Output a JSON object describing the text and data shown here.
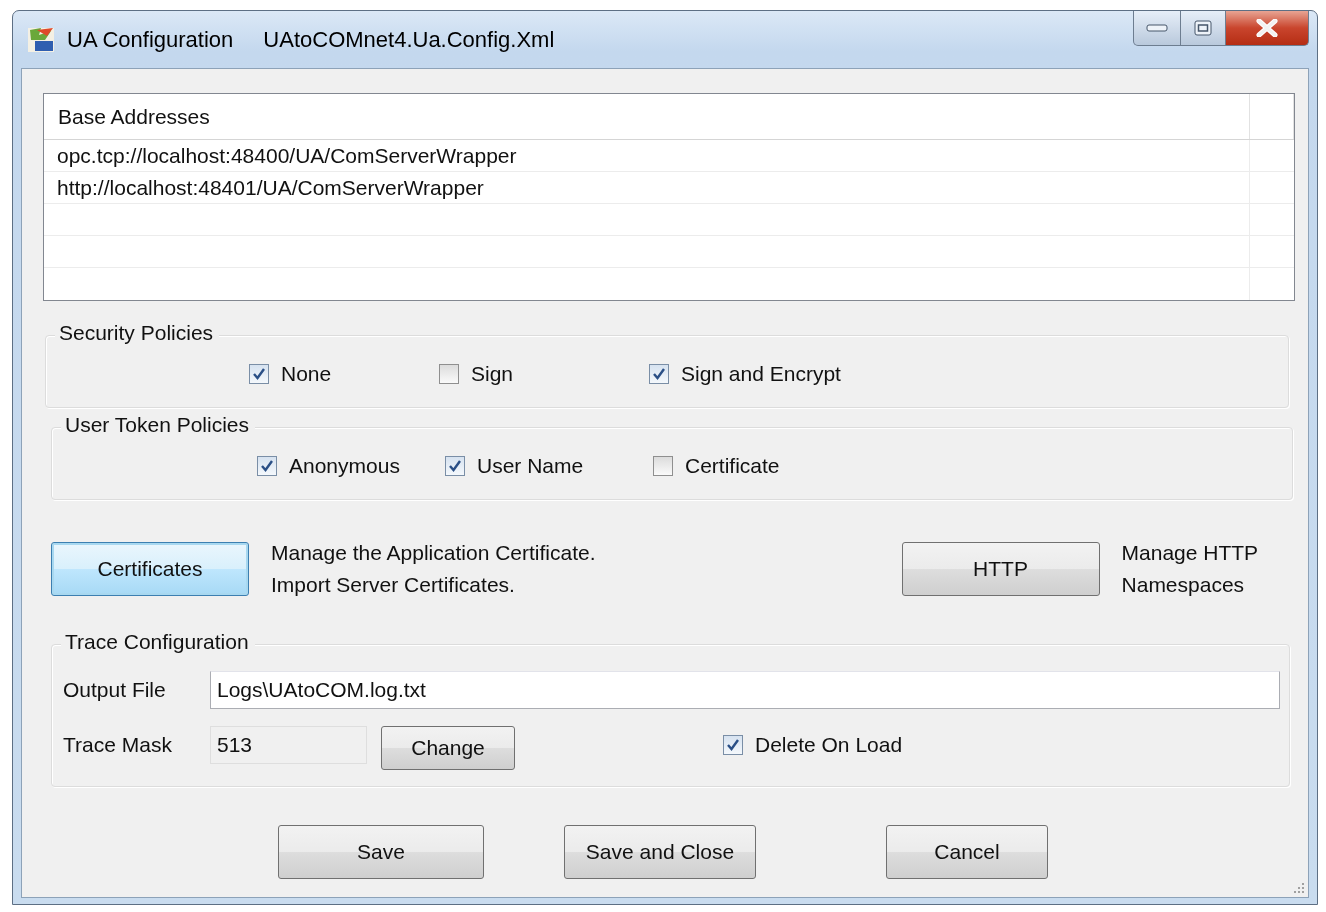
{
  "window": {
    "title": "UA Configuration",
    "file": "UAtoCOMnet4.Ua.Config.Xml"
  },
  "base_addresses": {
    "header": "Base Addresses",
    "rows": [
      "opc.tcp://localhost:48400/UA/ComServerWrapper",
      "http://localhost:48401/UA/ComServerWrapper"
    ]
  },
  "security_policies": {
    "label": "Security Policies",
    "options": [
      {
        "label": "None",
        "checked": true
      },
      {
        "label": "Sign",
        "checked": false
      },
      {
        "label": "Sign and Encrypt",
        "checked": true
      }
    ]
  },
  "user_token_policies": {
    "label": "User Token Policies",
    "options": [
      {
        "label": "Anonymous",
        "checked": true
      },
      {
        "label": "User Name",
        "checked": true
      },
      {
        "label": "Certificate",
        "checked": false
      }
    ]
  },
  "certificates": {
    "button": "Certificates",
    "focused": true,
    "description": [
      "Manage the Application Certificate.",
      "Import Server Certificates."
    ]
  },
  "http": {
    "button": "HTTP",
    "focused": false,
    "description": [
      "Manage HTTP",
      "Namespaces"
    ]
  },
  "trace": {
    "label": "Trace Configuration",
    "output_file": {
      "label": "Output File",
      "value": "Logs\\UAtoCOM.log.txt"
    },
    "trace_mask": {
      "label": "Trace Mask",
      "value": "513",
      "disabled": true
    },
    "change_button": "Change",
    "delete_on_load": {
      "label": "Delete On Load",
      "checked": true
    }
  },
  "buttons": [
    "Save",
    "Save and Close",
    "Cancel"
  ]
}
